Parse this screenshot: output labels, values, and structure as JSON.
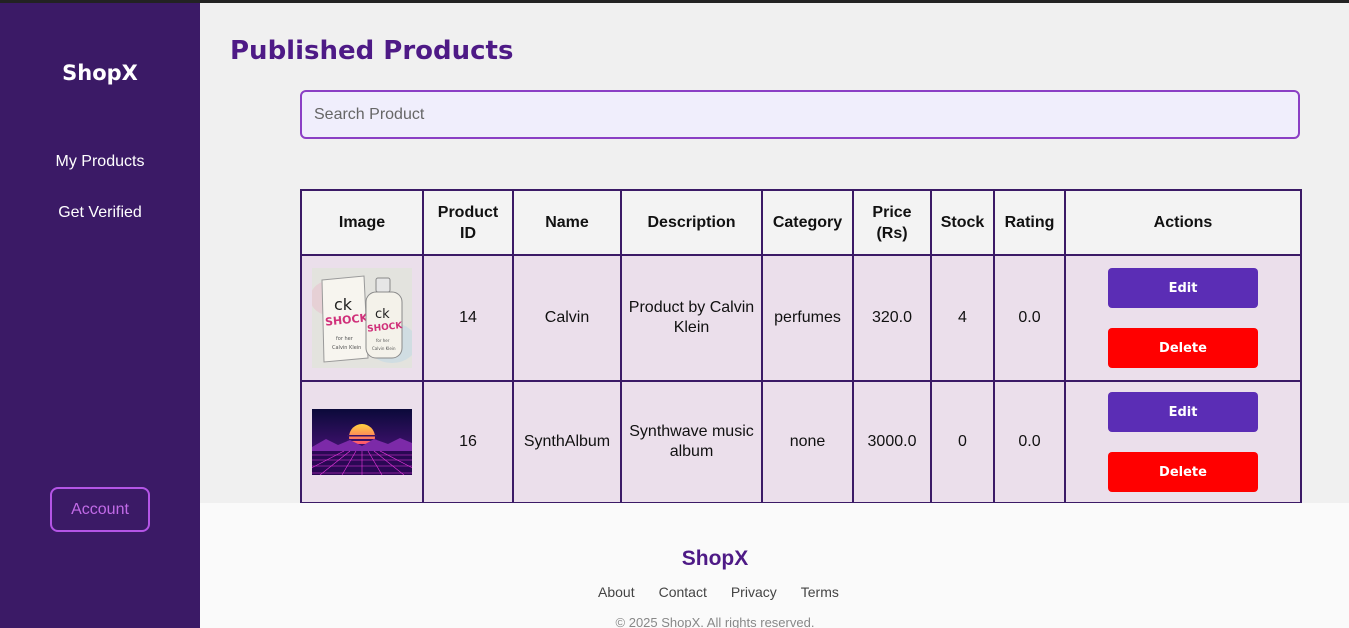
{
  "sidebar": {
    "brand": "ShopX",
    "nav": [
      {
        "label": "My Products"
      },
      {
        "label": "Get Verified"
      }
    ],
    "account_label": "Account"
  },
  "main": {
    "title": "Published Products",
    "search": {
      "placeholder": "Search Product",
      "value": ""
    },
    "table": {
      "headers": [
        "Image",
        "Product ID",
        "Name",
        "Description",
        "Category",
        "Price (Rs)",
        "Stock",
        "Rating",
        "Actions"
      ],
      "rows": [
        {
          "image": "perfume-box-image",
          "product_id": "14",
          "name": "Calvin",
          "description": "Product by Calvin Klein",
          "category": "perfumes",
          "price": "320.0",
          "stock": "4",
          "rating": "0.0",
          "edit_label": "Edit",
          "delete_label": "Delete"
        },
        {
          "image": "synthwave-sunset-image",
          "product_id": "16",
          "name": "SynthAlbum",
          "description": "Synthwave music album",
          "category": "none",
          "price": "3000.0",
          "stock": "0",
          "rating": "0.0",
          "edit_label": "Edit",
          "delete_label": "Delete"
        }
      ]
    }
  },
  "footer": {
    "brand": "ShopX",
    "links": [
      "About",
      "Contact",
      "Privacy",
      "Terms"
    ],
    "copyright": "© 2025 ShopX. All rights reserved."
  },
  "colors": {
    "sidebar_bg": "#3b1a66",
    "accent": "#4e1a86",
    "edit_button": "#5b2db5",
    "delete_button": "#ff0000",
    "row_bg": "#ebdfeb"
  }
}
